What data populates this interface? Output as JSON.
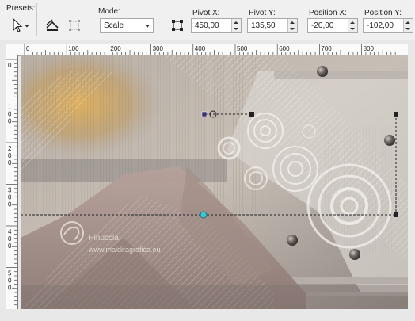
{
  "toolbar": {
    "presets_label": "Presets:",
    "mode_label": "Mode:",
    "mode_value": "Scale",
    "fields": [
      {
        "label": "Pivot X:",
        "value": "450,00"
      },
      {
        "label": "Pivot Y:",
        "value": "135,50"
      },
      {
        "label": "Position X:",
        "value": "-20,00"
      },
      {
        "label": "Position Y:",
        "value": "-102,00"
      }
    ]
  },
  "icons": {
    "presets": "pick-arrow-icon",
    "tool2": "merge-layers-icon",
    "tool3": "bounding-box-icon",
    "tool4": "transform-frame-icon"
  },
  "rulers": {
    "h_labels": [
      "0",
      "100",
      "200",
      "300",
      "400",
      "500",
      "600",
      "700",
      "800"
    ],
    "v_labels": [
      "0",
      "1\n0\n0",
      "2\n0\n0",
      "3\n0\n0",
      "4\n0\n0",
      "5\n0\n0"
    ]
  },
  "watermark": {
    "line1": "Pinuccia",
    "line2": "www.maidiragrafica.eu"
  },
  "colors": {
    "handle_cyan": "#3fc6d6",
    "canvas_warm": "#c9a35a",
    "canvas_mauve": "#9b8580"
  }
}
